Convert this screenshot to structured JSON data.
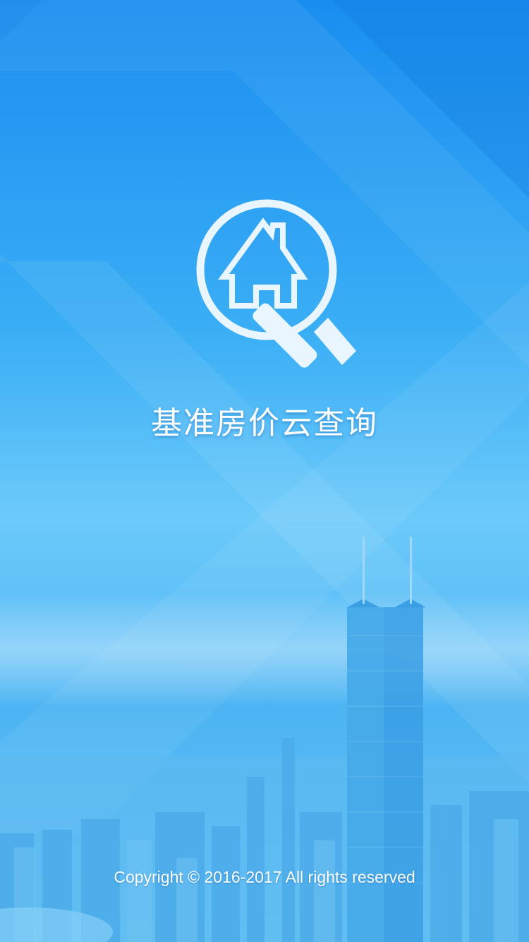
{
  "splash": {
    "app_title": "基准房价云查询",
    "copyright": "Copyright © 2016-2017 All rights reserved",
    "logo_icon": "house-magnifier-icon",
    "background": "city-skyline-illustration"
  },
  "colors": {
    "sky_top": "#1a8ef0",
    "sky_mid": "#6ccafa",
    "text": "#ffffff"
  }
}
